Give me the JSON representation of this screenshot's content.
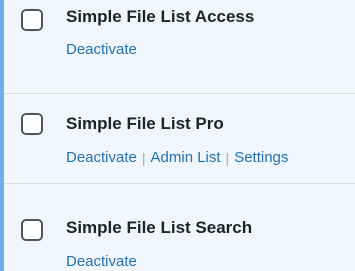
{
  "plugins": [
    {
      "name": "Simple File List Access",
      "actions": {
        "deactivate": "Deactivate"
      }
    },
    {
      "name": "Simple File List Pro",
      "actions": {
        "deactivate": "Deactivate",
        "admin_list": "Admin List",
        "settings": "Settings"
      }
    },
    {
      "name": "Simple File List Search",
      "actions": {
        "deactivate": "Deactivate"
      }
    }
  ],
  "separator": "|",
  "colors": {
    "active_border": "#72aee6",
    "active_row_bg": "#f0f6fc",
    "link": "#2271b1",
    "title": "#1d2327",
    "separator": "#a7aaad"
  }
}
